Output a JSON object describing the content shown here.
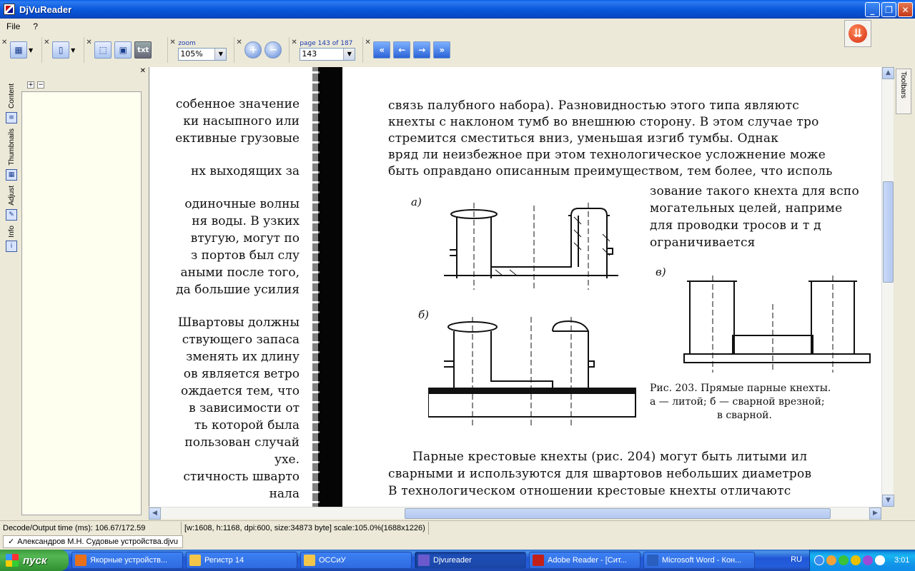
{
  "window": {
    "title": "DjVuReader"
  },
  "menu": {
    "items": [
      "File",
      "?"
    ]
  },
  "toolbar": {
    "zoom_label": "zoom",
    "zoom_value": "105%",
    "page_label": "page 143 of 187",
    "page_value": "143",
    "txt_label": "txt"
  },
  "sidebar": {
    "tabs": [
      "Content",
      "Thumbnails",
      "Adjust",
      "Info"
    ]
  },
  "toolbars_tab": "Toolbars",
  "document": {
    "left_lines": [
      "собенное значение",
      "ки насыпного или",
      "ективные грузовые",
      "",
      "нх  выходящих за",
      "",
      "одиночные волны",
      "ня воды. В узких",
      "втугую, могут по",
      "з портов был слу",
      "аными после того,",
      "да большие усилия",
      "",
      "Швартовы должны",
      "ствующего запаса",
      "зменять их длину",
      "ов является ветро",
      "ождается тем, что",
      "в зависимости от",
      "ть которой была",
      "пользован случай",
      "ухе.",
      "стичность шварто",
      "нала"
    ],
    "right_top": [
      "связь палубного набора). Разновидностью этого типа являютс",
      "кнехты с наклоном тумб во внешнюю сторону. В этом случае тро",
      "стремится сместиться вниз, уменьшая изгиб тумбы. Однак",
      "вряд ли неизбежное при этом технологическое усложнение може",
      "быть оправдано описанным преимуществом, тем более, что исполь"
    ],
    "right_mid": [
      "зование такого кнехта для вспо",
      "могательных целей, наприме",
      "для проводки тросов и т д",
      "ограничивается"
    ],
    "fig_a": "а)",
    "fig_b": "б)",
    "fig_v": "в)",
    "caption": [
      "Рис. 203. Прямые парные кнехты.",
      "а — литой;  б — сварной врезной;",
      "в      сварной."
    ],
    "right_bottom": [
      "Парные крестовые кнехты (рис. 204) могут быть литыми ил",
      "сварными и используются для швартовов небольших диаметров",
      "В технологическом отношении  крестовые  кнехты  отличаютс"
    ]
  },
  "status": {
    "decode": "Decode/Output time (ms): 106.67/172.59",
    "info": "[w:1608, h:1168, dpi:600, size:34873 byte] scale:105.0%(1688x1226)"
  },
  "file_tab": "Александров М.Н. Судовые устройства.djvu",
  "taskbar": {
    "start": "пуск",
    "tasks": [
      {
        "label": "Якорные устройств...",
        "color": "#e8701a"
      },
      {
        "label": "Регистр 14",
        "color": "#f3c64a"
      },
      {
        "label": "ОССиУ",
        "color": "#f3c64a"
      },
      {
        "label": "Djvureader",
        "color": "#6a5acd"
      },
      {
        "label": "Adobe Reader - [Сит...",
        "color": "#c4201a"
      },
      {
        "label": "Microsoft Word - Кон...",
        "color": "#2a5fbf"
      }
    ],
    "lang": "RU",
    "clock": "3:01"
  }
}
